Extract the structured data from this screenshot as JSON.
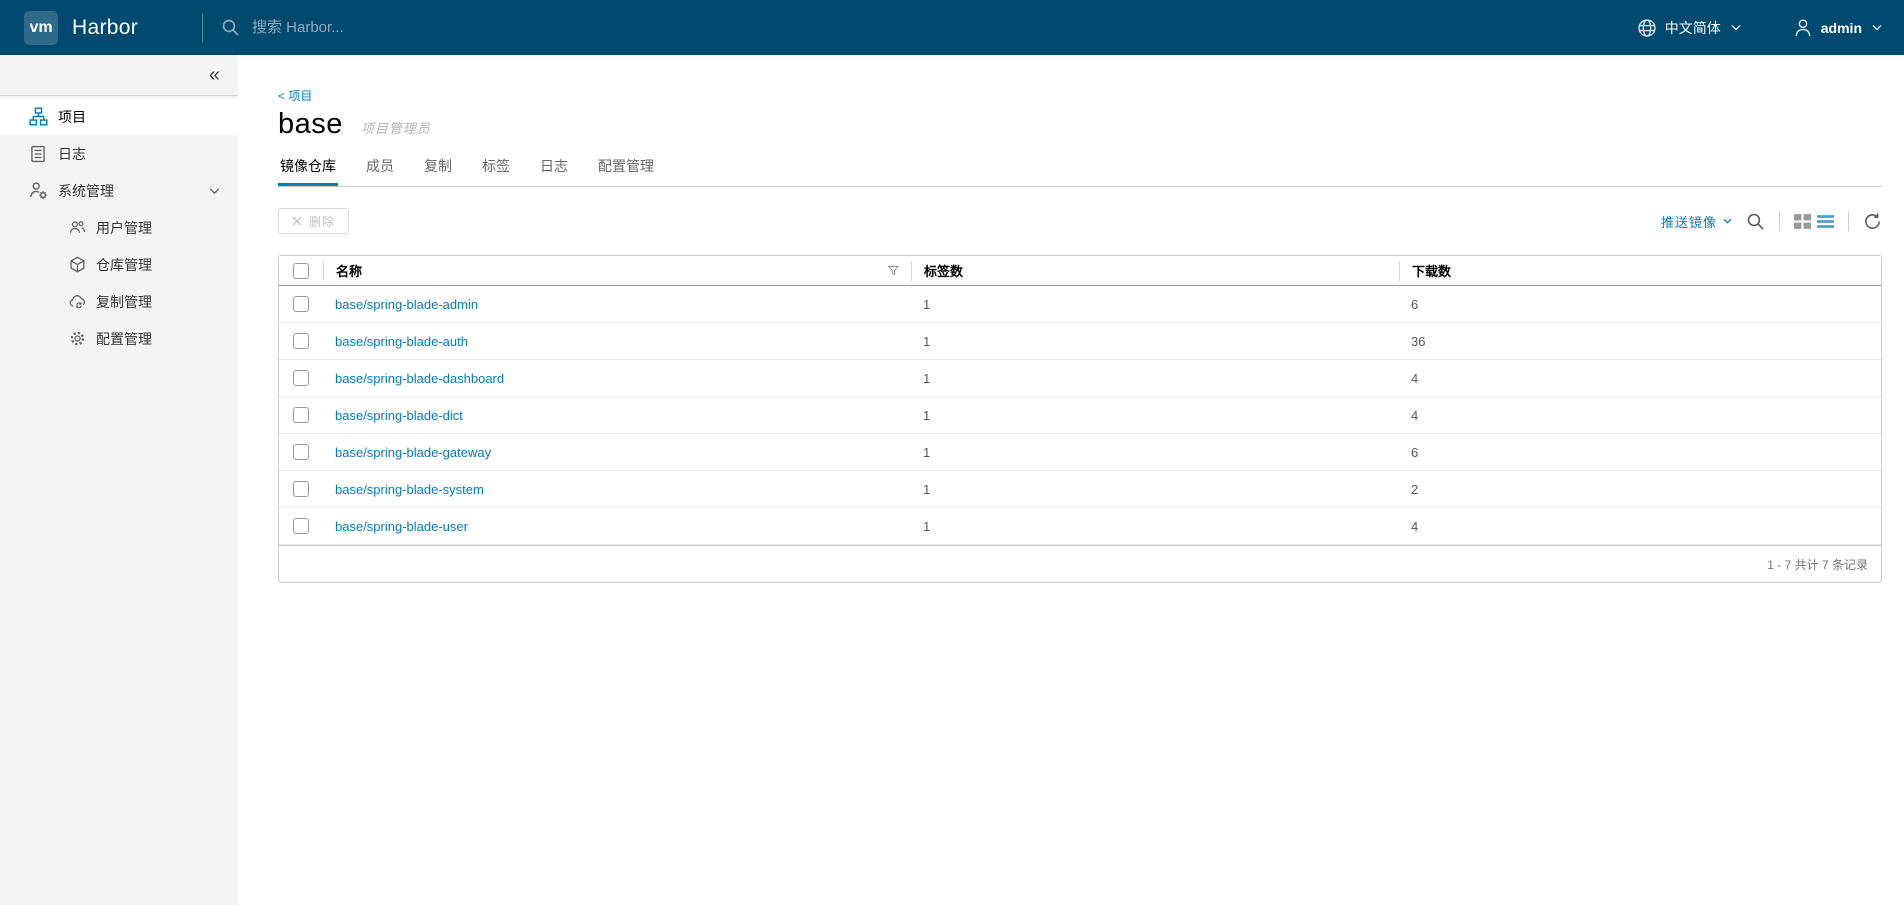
{
  "colors": {
    "header_bg": "#004a70",
    "accent": "#007cbb",
    "link": "#007cbb"
  },
  "header": {
    "logo_text": "vm",
    "app_name": "Harbor",
    "search_placeholder": "搜索 Harbor...",
    "language_label": "中文简体",
    "user_name": "admin"
  },
  "sidebar": {
    "items": [
      {
        "label": "项目",
        "icon": "projects-icon",
        "active": true
      },
      {
        "label": "日志",
        "icon": "logs-icon",
        "active": false
      },
      {
        "label": "系统管理",
        "icon": "admin-icon",
        "active": false,
        "expanded": true
      }
    ],
    "admin_subitems": [
      {
        "label": "用户管理",
        "icon": "users-icon"
      },
      {
        "label": "仓库管理",
        "icon": "registry-icon"
      },
      {
        "label": "复制管理",
        "icon": "replication-icon"
      },
      {
        "label": "配置管理",
        "icon": "config-icon"
      }
    ]
  },
  "main": {
    "breadcrumb": "< 项目",
    "title": "base",
    "role": "项目管理员",
    "tabs": [
      {
        "label": "镜像仓库",
        "active": true
      },
      {
        "label": "成员",
        "active": false
      },
      {
        "label": "复制",
        "active": false
      },
      {
        "label": "标签",
        "active": false
      },
      {
        "label": "日志",
        "active": false
      },
      {
        "label": "配置管理",
        "active": false
      }
    ],
    "toolbar": {
      "delete_label": "删除",
      "push_image_label": "推送镜像"
    },
    "table": {
      "columns": [
        "名称",
        "标签数",
        "下载数"
      ],
      "rows": [
        {
          "name": "base/spring-blade-admin",
          "tags": "1",
          "downloads": "6"
        },
        {
          "name": "base/spring-blade-auth",
          "tags": "1",
          "downloads": "36"
        },
        {
          "name": "base/spring-blade-dashboard",
          "tags": "1",
          "downloads": "4"
        },
        {
          "name": "base/spring-blade-dict",
          "tags": "1",
          "downloads": "4"
        },
        {
          "name": "base/spring-blade-gateway",
          "tags": "1",
          "downloads": "6"
        },
        {
          "name": "base/spring-blade-system",
          "tags": "1",
          "downloads": "2"
        },
        {
          "name": "base/spring-blade-user",
          "tags": "1",
          "downloads": "4"
        }
      ],
      "footer": "1 - 7 共计 7 条记录"
    }
  }
}
